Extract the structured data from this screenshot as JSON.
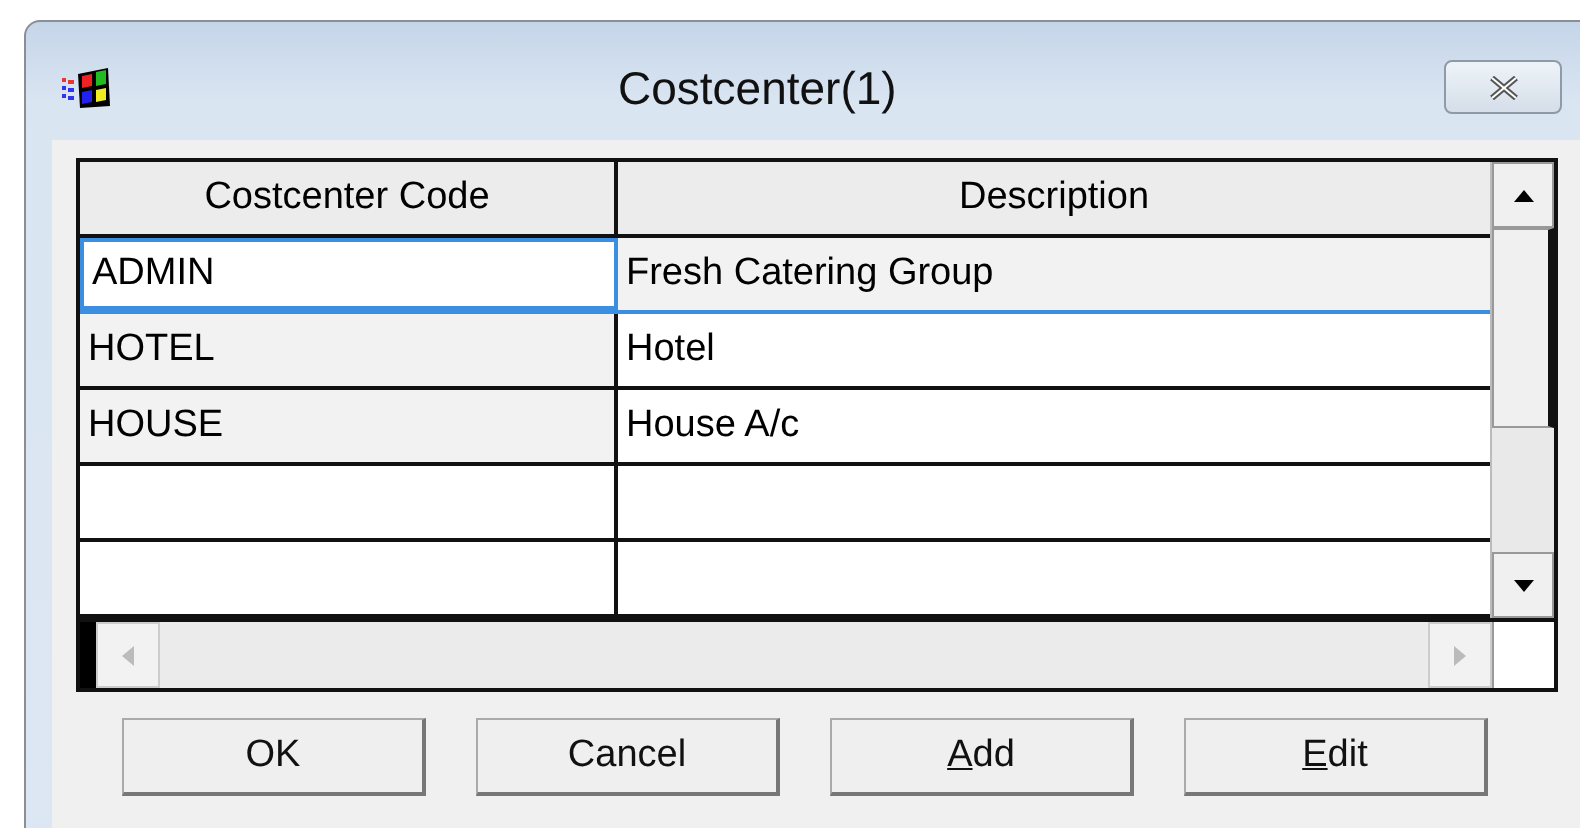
{
  "window": {
    "title": "Costcenter(1)"
  },
  "table": {
    "columns": [
      "Costcenter Code",
      "Description"
    ],
    "rows": [
      {
        "cells": [
          "ADMIN",
          "Fresh Catering Group"
        ],
        "selected": true
      },
      {
        "cells": [
          "HOTEL",
          "Hotel"
        ],
        "selected": false
      },
      {
        "cells": [
          "HOUSE",
          "House A/c"
        ],
        "selected": false
      },
      {
        "cells": [
          "",
          ""
        ],
        "selected": false
      },
      {
        "cells": [
          "",
          ""
        ],
        "selected": false
      }
    ]
  },
  "buttons": [
    {
      "label": "OK",
      "mnemonic": false
    },
    {
      "label": "Cancel",
      "mnemonic": false
    },
    {
      "label": "Add",
      "mnemonic": true
    },
    {
      "label": "Edit",
      "mnemonic": true
    }
  ]
}
